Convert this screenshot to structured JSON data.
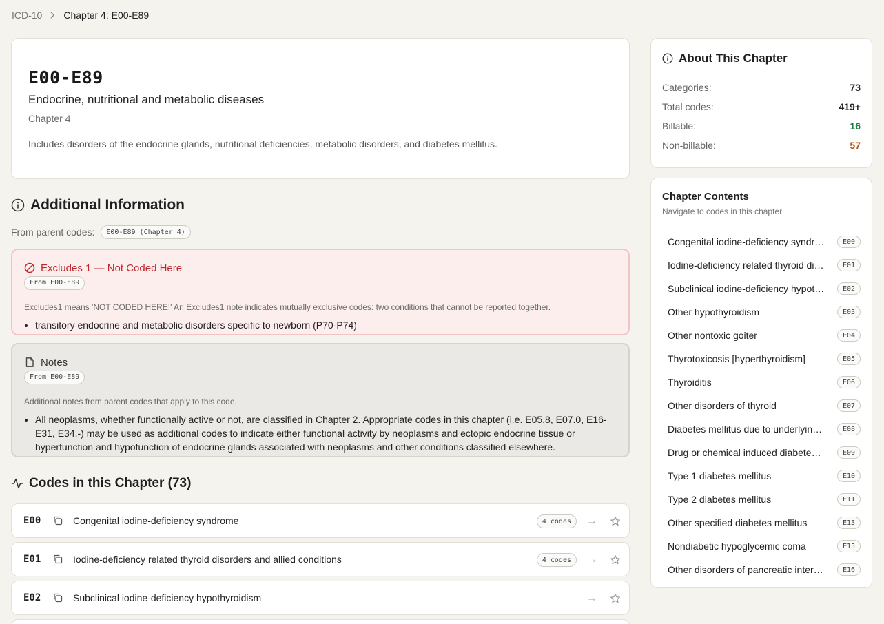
{
  "breadcrumb": {
    "root": "ICD-10",
    "current": "Chapter 4: E00-E89"
  },
  "hero": {
    "code": "E00-E89",
    "title": "Endocrine, nutritional and metabolic diseases",
    "chapter": "Chapter 4",
    "description": "Includes disorders of the endocrine glands, nutritional deficiencies, metabolic disorders, and diabetes mellitus."
  },
  "additional": {
    "title": "Additional Information",
    "from_parent_label": "From parent codes:",
    "parent_pill": "E00-E89 (Chapter 4)",
    "excludes": {
      "title": "Excludes 1 — Not Coded Here",
      "source": "From E00-E89",
      "subtitle": "Excludes1 means 'NOT CODED HERE!' An Excludes1 note indicates mutually exclusive codes: two conditions that cannot be reported together.",
      "items": [
        "transitory endocrine and metabolic disorders specific to newborn (P70-P74)"
      ]
    },
    "notes": {
      "title": "Notes",
      "source": "From E00-E89",
      "subtitle": "Additional notes from parent codes that apply to this code.",
      "items": [
        "All neoplasms, whether functionally active or not, are classified in Chapter 2. Appropriate codes in this chapter (i.e. E05.8, E07.0, E16-E31, E34.-) may be used as additional codes to indicate either functional activity by neoplasms and ectopic endocrine tissue or hyperfunction and hypofunction of endocrine glands associated with neoplasms and other conditions classified elsewhere."
      ]
    }
  },
  "codes": {
    "title": "Codes in this Chapter (73)",
    "rows": [
      {
        "code": "E00",
        "name": "Congenital iodine-deficiency syndrome",
        "count": "4 codes"
      },
      {
        "code": "E01",
        "name": "Iodine-deficiency related thyroid disorders and allied conditions",
        "count": "4 codes"
      },
      {
        "code": "E02",
        "name": "Subclinical iodine-deficiency hypothyroidism",
        "count": ""
      }
    ],
    "arrow": "→"
  },
  "about": {
    "title": "About This Chapter",
    "stats": [
      {
        "label": "Categories:",
        "value": "73"
      },
      {
        "label": "Total codes:",
        "value": "419+"
      },
      {
        "label": "Billable:",
        "value": "16"
      },
      {
        "label": "Non-billable:",
        "value": "57"
      }
    ]
  },
  "contents": {
    "title": "Chapter Contents",
    "subtitle": "Navigate to codes in this chapter",
    "items": [
      {
        "name": "Congenital iodine-deficiency syndrome",
        "code": "E00"
      },
      {
        "name": "Iodine-deficiency related thyroid disorders and allied conditions",
        "code": "E01"
      },
      {
        "name": "Subclinical iodine-deficiency hypothyroidism",
        "code": "E02"
      },
      {
        "name": "Other hypothyroidism",
        "code": "E03"
      },
      {
        "name": "Other nontoxic goiter",
        "code": "E04"
      },
      {
        "name": "Thyrotoxicosis [hyperthyroidism]",
        "code": "E05"
      },
      {
        "name": "Thyroiditis",
        "code": "E06"
      },
      {
        "name": "Other disorders of thyroid",
        "code": "E07"
      },
      {
        "name": "Diabetes mellitus due to underlying condition",
        "code": "E08"
      },
      {
        "name": "Drug or chemical induced diabetes mellitus",
        "code": "E09"
      },
      {
        "name": "Type 1 diabetes mellitus",
        "code": "E10"
      },
      {
        "name": "Type 2 diabetes mellitus",
        "code": "E11"
      },
      {
        "name": "Other specified diabetes mellitus",
        "code": "E13"
      },
      {
        "name": "Nondiabetic hypoglycemic coma",
        "code": "E15"
      },
      {
        "name": "Other disorders of pancreatic internal secretion",
        "code": "E16"
      }
    ]
  },
  "colors": {
    "background": "#f5f3ee",
    "excludes_red": "#c0272d",
    "billable_green": "#1c7a42",
    "nonbillable_orange": "#b25a12"
  },
  "icons": [
    "chevron-right-icon",
    "info-icon",
    "ban-icon",
    "file-icon",
    "activity-icon",
    "copy-icon",
    "arrow-right-icon",
    "star-icon"
  ]
}
